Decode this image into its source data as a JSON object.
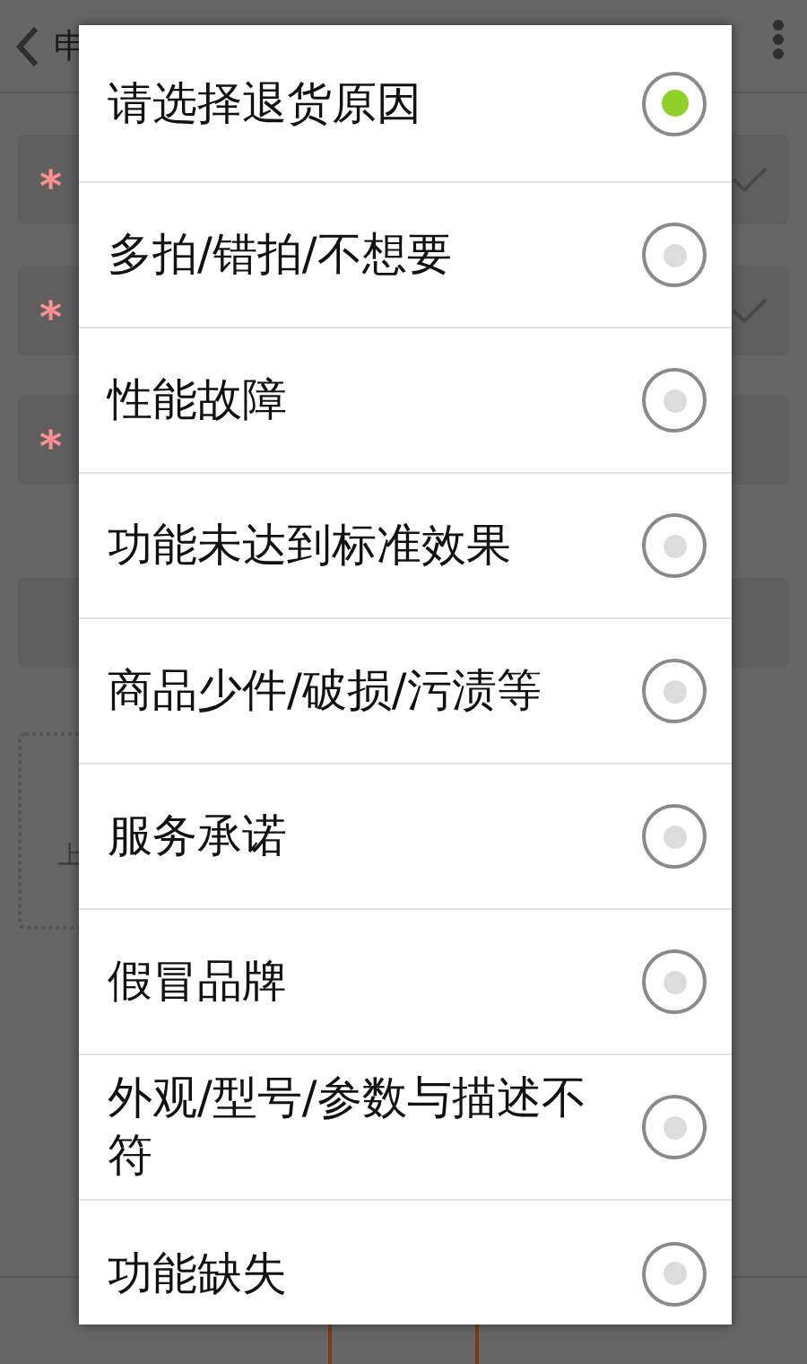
{
  "background": {
    "title": "申",
    "required_marks": [
      "*",
      "*",
      "*"
    ],
    "upload_label": "上"
  },
  "dialog": {
    "options": [
      {
        "label": "请选择退货原因",
        "selected": true
      },
      {
        "label": "多拍/错拍/不想要",
        "selected": false
      },
      {
        "label": "性能故障",
        "selected": false
      },
      {
        "label": "功能未达到标准效果",
        "selected": false
      },
      {
        "label": "商品少件/破损/污渍等",
        "selected": false
      },
      {
        "label": "服务承诺",
        "selected": false
      },
      {
        "label": "假冒品牌",
        "selected": false
      },
      {
        "label": "外观/型号/参数与描述不符",
        "selected": false
      },
      {
        "label": "功能缺失",
        "selected": false
      }
    ]
  }
}
